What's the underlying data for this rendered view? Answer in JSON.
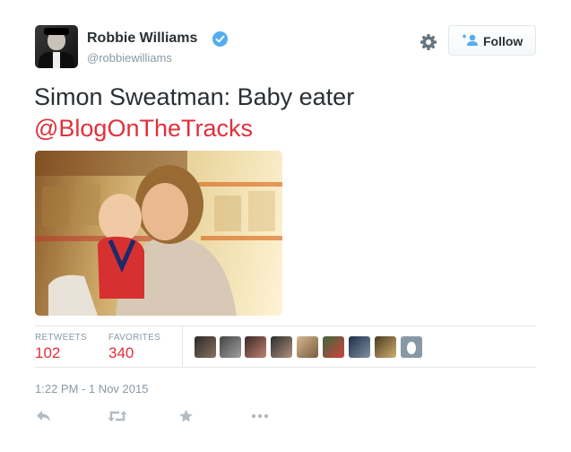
{
  "tweet": {
    "author": {
      "name": "Robbie Williams",
      "handle": "@robbiewilliams",
      "verified": true
    },
    "follow_label": "Follow",
    "text": "Simon Sweatman: Baby eater",
    "mention": "@BlogOnTheTracks",
    "stats": {
      "retweets_label": "RETWEETS",
      "retweets_count": "102",
      "favorites_label": "FAVORITES",
      "favorites_count": "340"
    },
    "favoriter_avatar_count": 9,
    "timestamp": "1:22 PM - 1 Nov 2015"
  },
  "colors": {
    "accent": "#e0303a",
    "verified": "#55acee",
    "muted": "#8899a6"
  },
  "icons": [
    "gear-icon",
    "follow-person-icon",
    "verified-icon",
    "reply-icon",
    "retweet-icon",
    "favorite-icon",
    "more-icon"
  ]
}
